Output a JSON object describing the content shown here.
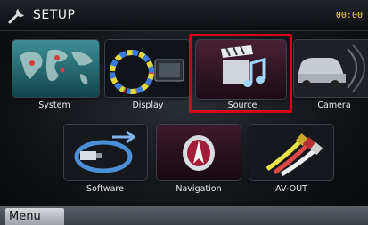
{
  "header": {
    "title": "SETUP",
    "clock": "00:00",
    "icon": "wrench-icon"
  },
  "tiles": {
    "system": {
      "label": "System",
      "icon": "world-map-icon"
    },
    "display": {
      "label": "Display",
      "icon": "color-wheel-icon"
    },
    "source": {
      "label": "Source",
      "icon": "clapperboard-music-icon",
      "selected": true
    },
    "camera": {
      "label": "Camera",
      "icon": "car-camera-icon"
    },
    "software": {
      "label": "Software",
      "icon": "usb-arrow-icon"
    },
    "navigation": {
      "label": "Navigation",
      "icon": "compass-icon"
    },
    "avout": {
      "label": "AV-OUT",
      "icon": "rca-cable-icon"
    }
  },
  "bottom": {
    "menu_label": "Menu"
  },
  "colors": {
    "highlight": "#d6001c",
    "accent": "#ffd34a"
  }
}
